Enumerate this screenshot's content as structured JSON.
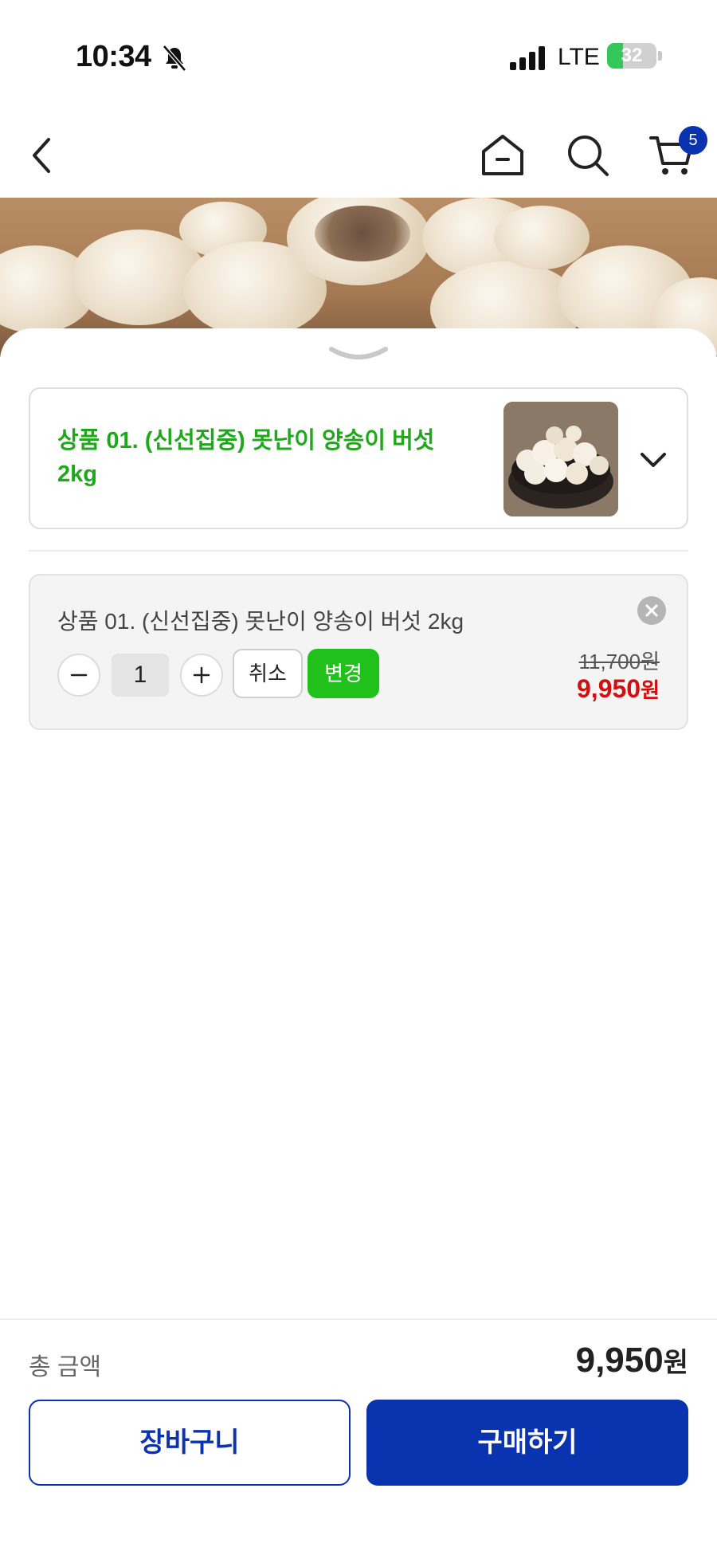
{
  "status_bar": {
    "time": "10:34",
    "network": "LTE",
    "battery_level": "32",
    "battery_percent": 32,
    "icons": [
      "bell-slash-icon",
      "cellular-signal-icon",
      "battery-charging-icon"
    ]
  },
  "nav": {
    "icons": [
      "chevron-left-icon",
      "home-icon",
      "search-icon",
      "cart-icon"
    ],
    "cart_badge": "5"
  },
  "option_select": {
    "title": "상품 01. (신선집중) 못난이 양송이 버섯 2kg"
  },
  "selected_item": {
    "name": "상품 01. (신선집중) 못난이 양송이 버섯 2kg",
    "quantity": "1",
    "cancel_label": "취소",
    "change_label": "변경",
    "original_price": "11,700원",
    "sale_price": "9,950",
    "sale_currency": "원"
  },
  "footer": {
    "total_label": "총 금액",
    "total_price": "9,950",
    "total_currency": "원",
    "cart_button": "장바구니",
    "buy_button": "구매하기"
  },
  "colors": {
    "brand_blue": "#0a33b0",
    "option_green": "#1fa81a",
    "change_green": "#1fc11a",
    "sale_red": "#d20f0f"
  }
}
